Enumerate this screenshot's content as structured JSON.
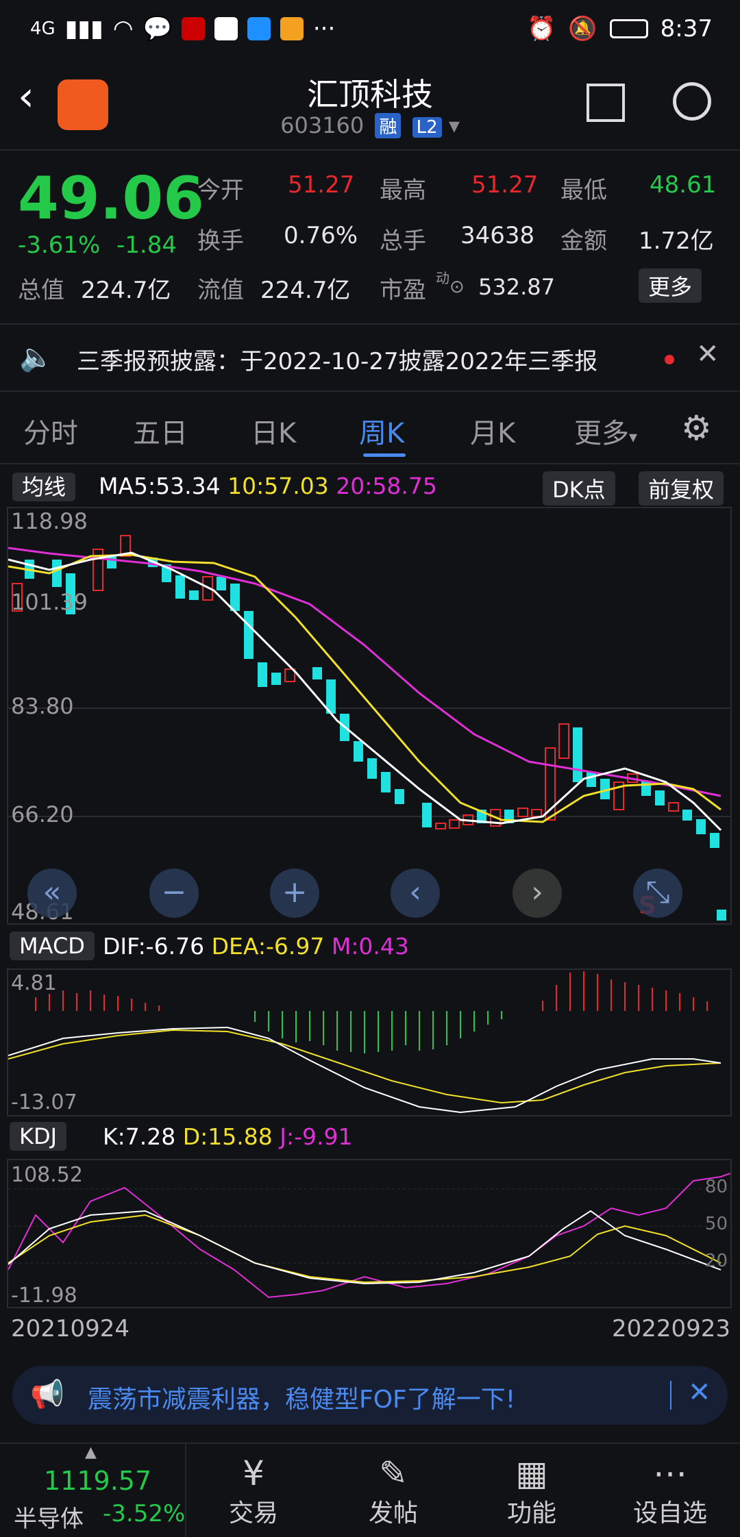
{
  "status_bar": {
    "signal": "4G",
    "time": "8:37"
  },
  "header": {
    "title": "汇顶科技",
    "code": "603160",
    "tag1": "融",
    "tag2": "L2"
  },
  "quote": {
    "price": "49.06",
    "change_pct": "-3.61%",
    "change_amt": "-1.84",
    "open_label": "今开",
    "open": "51.27",
    "high_label": "最高",
    "high": "51.27",
    "low_label": "最低",
    "low": "48.61",
    "turnover_label": "换手",
    "turnover": "0.76%",
    "volume_label": "总手",
    "volume": "34638",
    "amount_label": "金额",
    "amount": "1.72亿",
    "mcap_label": "总值",
    "mcap": "224.7亿",
    "float_label": "流值",
    "float": "224.7亿",
    "pe_label": "市盈",
    "pe_sup": "动",
    "pe": "532.87",
    "more_button": "更多"
  },
  "notice": {
    "text": "三季报预披露：于2022-10-27披露2022年三季报"
  },
  "tabs": [
    "分时",
    "五日",
    "日K",
    "周K",
    "月K",
    "更多"
  ],
  "active_tab": "周K",
  "kline": {
    "indicator": "均线",
    "ma5": "MA5:53.34",
    "ma10": "10:57.03",
    "ma20": "20:58.75",
    "dk_button": "DK点",
    "adj_button": "前复权",
    "y_labels": [
      "118.98",
      "101.39",
      "83.80",
      "66.20",
      "48.61"
    ],
    "signal_label": "S"
  },
  "macd": {
    "name": "MACD",
    "dif": "DIF:-6.76",
    "dea": "DEA:-6.97",
    "m": "M:0.43",
    "top": "4.81",
    "bottom": "-13.07"
  },
  "kdj": {
    "name": "KDJ",
    "k": "K:7.28",
    "d": "D:15.88",
    "j": "J:-9.91",
    "top": "108.52",
    "bottom": "-11.98",
    "levels": [
      "80",
      "50",
      "20"
    ]
  },
  "dates": {
    "start": "20210924",
    "end": "20220923"
  },
  "ad": {
    "text": "震荡市减震利器，稳健型FOF了解一下!"
  },
  "bottom_nav": {
    "index_value": "1119.57",
    "index_name": "半导体",
    "index_change": "-3.52%",
    "items": [
      "交易",
      "发帖",
      "功能",
      "设自选"
    ]
  },
  "colors": {
    "up": "#e8282d",
    "down": "#20e0e0",
    "ma5": "#ffffff",
    "ma10": "#f2e02a",
    "ma20": "#e02fd6",
    "accent": "#4a8af0"
  }
}
